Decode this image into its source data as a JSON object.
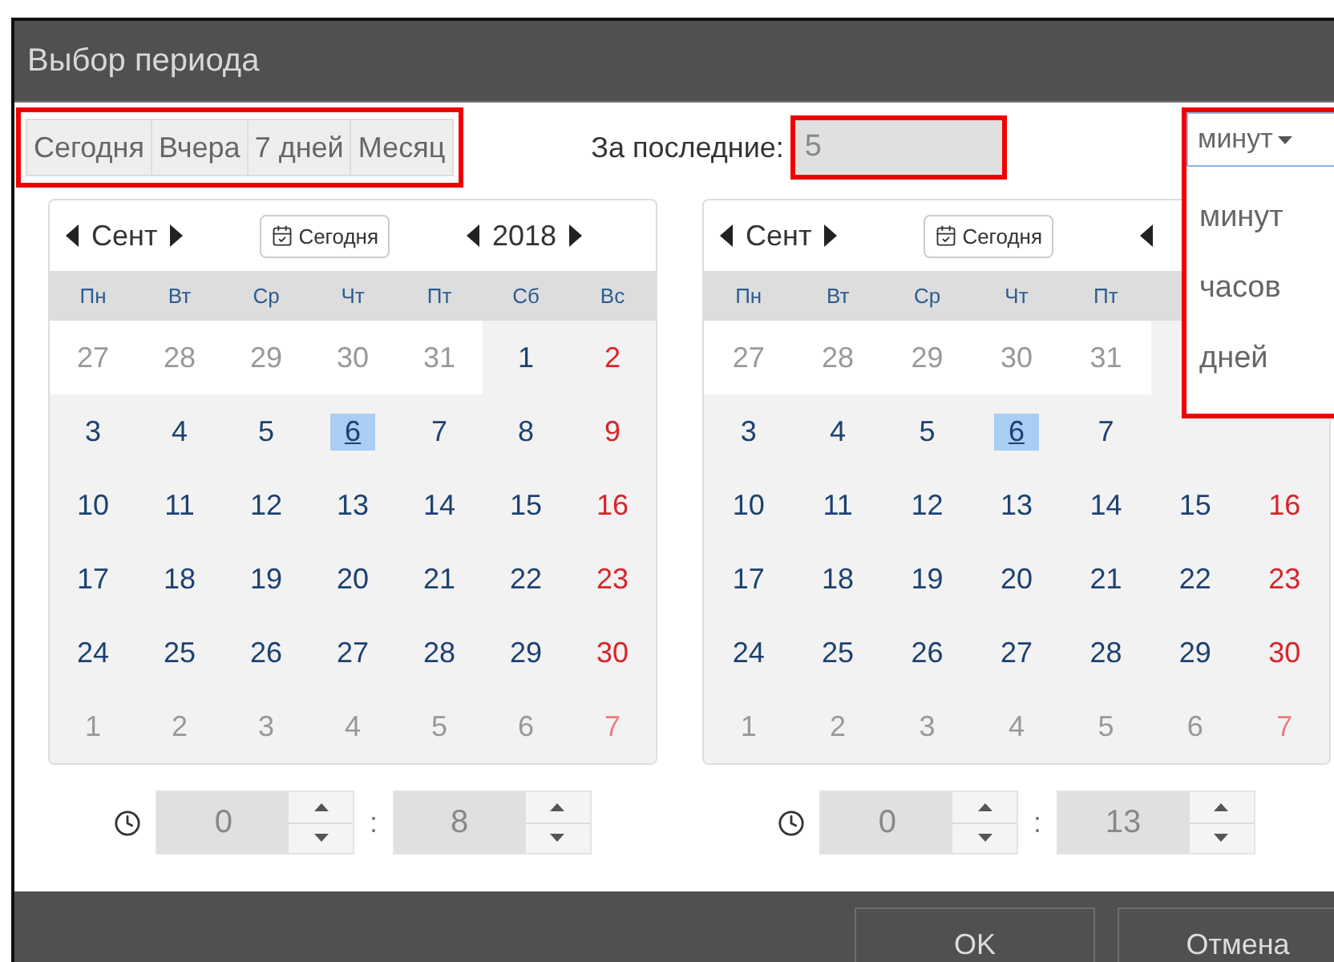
{
  "dialog": {
    "title": "Выбор периода"
  },
  "quick_ranges": {
    "highlighted": true,
    "buttons": [
      {
        "label": "Сегодня"
      },
      {
        "label": "Вчера"
      },
      {
        "label": "7 дней"
      },
      {
        "label": "Месяц"
      }
    ]
  },
  "last": {
    "label": "За последние:",
    "value": "5",
    "highlighted": true
  },
  "unit_select": {
    "value": "минут",
    "expanded": true,
    "highlighted": true,
    "options": [
      {
        "label": "минут"
      },
      {
        "label": "часов"
      },
      {
        "label": "дней"
      }
    ]
  },
  "calendars": [
    {
      "month": "Сент",
      "today_button": "Сегодня",
      "year": "2018",
      "weekdays": [
        "Пн",
        "Вт",
        "Ср",
        "Чт",
        "Пт",
        "Сб",
        "Вс"
      ],
      "weeks": [
        [
          {
            "day": "27",
            "kind": "prev"
          },
          {
            "day": "28",
            "kind": "prev"
          },
          {
            "day": "29",
            "kind": "prev"
          },
          {
            "day": "30",
            "kind": "prev"
          },
          {
            "day": "31",
            "kind": "prev"
          },
          {
            "day": "1",
            "kind": "day"
          },
          {
            "day": "2",
            "kind": "day"
          }
        ],
        [
          {
            "day": "3",
            "kind": "day"
          },
          {
            "day": "4",
            "kind": "day"
          },
          {
            "day": "5",
            "kind": "day"
          },
          {
            "day": "6",
            "kind": "today"
          },
          {
            "day": "7",
            "kind": "day"
          },
          {
            "day": "8",
            "kind": "day"
          },
          {
            "day": "9",
            "kind": "day"
          }
        ],
        [
          {
            "day": "10",
            "kind": "day"
          },
          {
            "day": "11",
            "kind": "day"
          },
          {
            "day": "12",
            "kind": "day"
          },
          {
            "day": "13",
            "kind": "day"
          },
          {
            "day": "14",
            "kind": "day"
          },
          {
            "day": "15",
            "kind": "day"
          },
          {
            "day": "16",
            "kind": "day"
          }
        ],
        [
          {
            "day": "17",
            "kind": "day"
          },
          {
            "day": "18",
            "kind": "day"
          },
          {
            "day": "19",
            "kind": "day"
          },
          {
            "day": "20",
            "kind": "day"
          },
          {
            "day": "21",
            "kind": "day"
          },
          {
            "day": "22",
            "kind": "day"
          },
          {
            "day": "23",
            "kind": "day"
          }
        ],
        [
          {
            "day": "24",
            "kind": "day"
          },
          {
            "day": "25",
            "kind": "day"
          },
          {
            "day": "26",
            "kind": "day"
          },
          {
            "day": "27",
            "kind": "day"
          },
          {
            "day": "28",
            "kind": "day"
          },
          {
            "day": "29",
            "kind": "day"
          },
          {
            "day": "30",
            "kind": "day"
          }
        ],
        [
          {
            "day": "1",
            "kind": "next"
          },
          {
            "day": "2",
            "kind": "next"
          },
          {
            "day": "3",
            "kind": "next"
          },
          {
            "day": "4",
            "kind": "next"
          },
          {
            "day": "5",
            "kind": "next"
          },
          {
            "day": "6",
            "kind": "next"
          },
          {
            "day": "7",
            "kind": "next"
          }
        ]
      ],
      "time": {
        "hours": "0",
        "separator": ":",
        "minutes": "8"
      }
    },
    {
      "month": "Сент",
      "today_button": "Сегодня",
      "weekdays": [
        "Пн",
        "Вт",
        "Ср",
        "Чт",
        "Пт"
      ],
      "weeks": [
        [
          {
            "day": "27",
            "kind": "prev"
          },
          {
            "day": "28",
            "kind": "prev"
          },
          {
            "day": "29",
            "kind": "prev"
          },
          {
            "day": "30",
            "kind": "prev"
          },
          {
            "day": "31",
            "kind": "prev"
          }
        ],
        [
          {
            "day": "3",
            "kind": "day"
          },
          {
            "day": "4",
            "kind": "day"
          },
          {
            "day": "5",
            "kind": "day"
          },
          {
            "day": "6",
            "kind": "today"
          },
          {
            "day": "7",
            "kind": "day"
          }
        ],
        [
          {
            "day": "10",
            "kind": "day"
          },
          {
            "day": "11",
            "kind": "day"
          },
          {
            "day": "12",
            "kind": "day"
          },
          {
            "day": "13",
            "kind": "day"
          },
          {
            "day": "14",
            "kind": "day"
          },
          {
            "day": "15",
            "kind": "day"
          },
          {
            "day": "16",
            "kind": "day"
          }
        ],
        [
          {
            "day": "17",
            "kind": "day"
          },
          {
            "day": "18",
            "kind": "day"
          },
          {
            "day": "19",
            "kind": "day"
          },
          {
            "day": "20",
            "kind": "day"
          },
          {
            "day": "21",
            "kind": "day"
          },
          {
            "day": "22",
            "kind": "day"
          },
          {
            "day": "23",
            "kind": "day"
          }
        ],
        [
          {
            "day": "24",
            "kind": "day"
          },
          {
            "day": "25",
            "kind": "day"
          },
          {
            "day": "26",
            "kind": "day"
          },
          {
            "day": "27",
            "kind": "day"
          },
          {
            "day": "28",
            "kind": "day"
          },
          {
            "day": "29",
            "kind": "day"
          },
          {
            "day": "30",
            "kind": "day"
          }
        ],
        [
          {
            "day": "1",
            "kind": "next"
          },
          {
            "day": "2",
            "kind": "next"
          },
          {
            "day": "3",
            "kind": "next"
          },
          {
            "day": "4",
            "kind": "next"
          },
          {
            "day": "5",
            "kind": "next"
          },
          {
            "day": "6",
            "kind": "next"
          },
          {
            "day": "7",
            "kind": "next"
          }
        ]
      ],
      "time": {
        "hours": "0",
        "separator": ":",
        "minutes": "13"
      }
    }
  ],
  "buttons": [
    {
      "label": "OK"
    },
    {
      "label": "Отмена"
    }
  ]
}
